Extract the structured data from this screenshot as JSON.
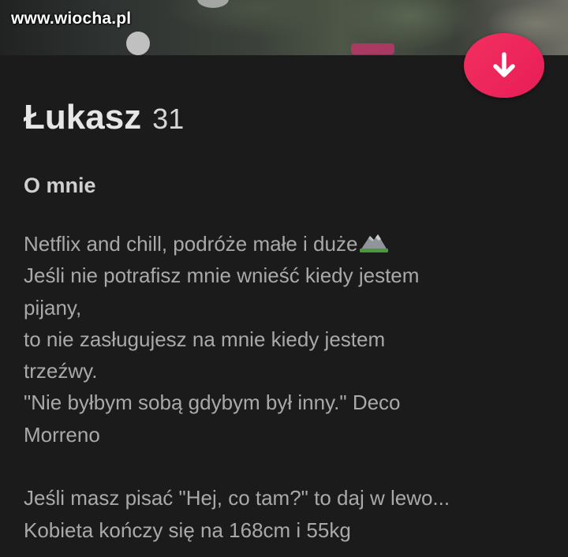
{
  "photo": {
    "watermark": "www.wiocha.pl"
  },
  "action_button": {
    "icon": "arrow-down-icon",
    "color": "#ed2558"
  },
  "profile": {
    "name": "Łukasz",
    "age": "31"
  },
  "about": {
    "title": "O mnie",
    "lines": [
      "Netflix and chill, podróże małe i duże",
      "Jeśli nie potrafisz mnie wnieść kiedy jestem",
      "pijany,",
      "to nie zasługujesz na mnie kiedy jestem",
      "trzeźwy.",
      "\"Nie byłbym sobą gdybym był inny.\" Deco",
      "Morreno",
      "",
      "Jeśli masz pisać \"Hej, co tam?\" to daj w lewo...",
      "Kobieta kończy się na 168cm i 55kg"
    ],
    "emoji": "mountain-icon"
  },
  "colors": {
    "background": "#1b1b1c",
    "name_text": "#e6e6e6",
    "bio_text": "#a9a9a9"
  }
}
